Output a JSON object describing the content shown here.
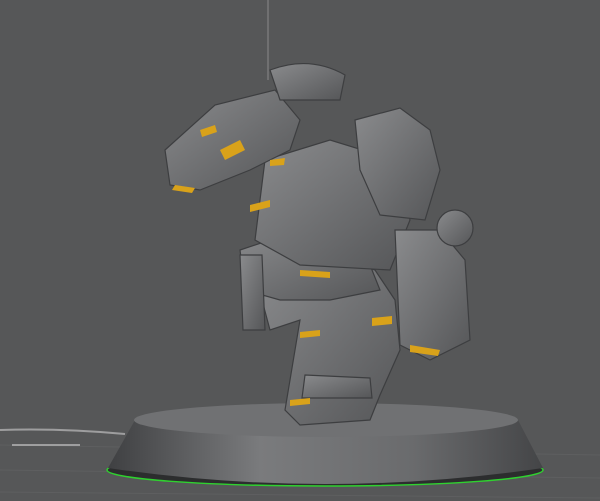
{
  "scene": {
    "background_color": "#565758",
    "model_color": "#7a7b7d",
    "accent_color": "#d9a21a",
    "selection_outline_color": "#2fd12f"
  }
}
